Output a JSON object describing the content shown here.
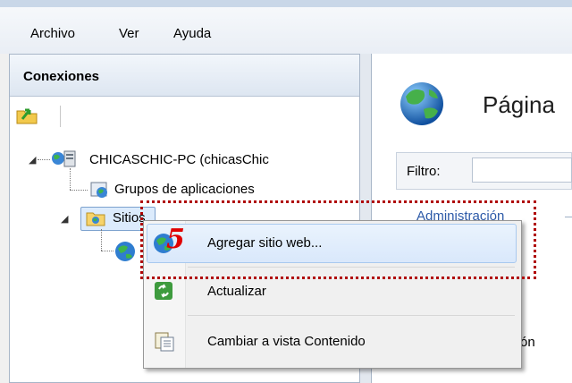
{
  "menubar": {
    "items": [
      "Archivo",
      "Ver",
      "Ayuda"
    ]
  },
  "connections": {
    "title": "Conexiones"
  },
  "tree": {
    "server": "CHICASCHIC-PC (chicasChic",
    "app_pools": "Grupos de aplicaciones",
    "sites": "Sitios"
  },
  "right_panel": {
    "title": "Página",
    "filter_label": "Filtro:",
    "section_header": "Administración",
    "partial_text": "ón"
  },
  "context_menu": {
    "items": [
      {
        "label": "Agregar sitio web...",
        "icon": "globe-icon",
        "highlighted": true
      },
      {
        "label": "Actualizar",
        "icon": "refresh-icon"
      },
      {
        "label": "Cambiar a vista Contenido",
        "icon": "content-view-icon"
      }
    ]
  },
  "annotation": {
    "step": "5",
    "color": "#e00000"
  },
  "colors": {
    "link": "#2d5aa8",
    "highlight_border": "#a9c9ef",
    "annotation_border": "#b00000"
  }
}
